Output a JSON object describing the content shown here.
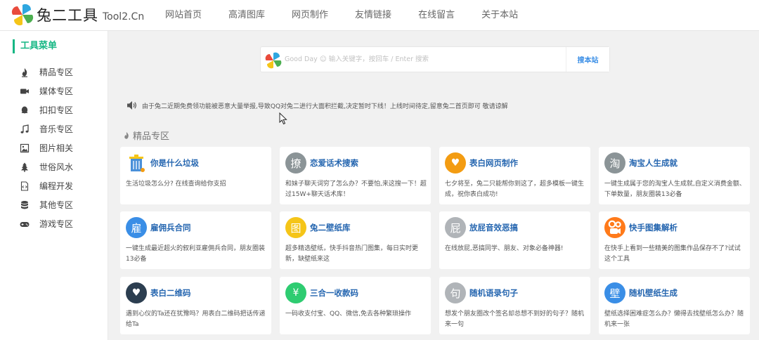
{
  "header": {
    "logo_text": "兔二工具",
    "logo_sub": "Tool2.Cn",
    "nav": [
      "网站首页",
      "高清图库",
      "网页制作",
      "友情链接",
      "在线留言",
      "关于本站"
    ]
  },
  "sidebar": {
    "title": "工具菜单",
    "items": [
      {
        "label": "精品专区",
        "icon": "flame-icon"
      },
      {
        "label": "媒体专区",
        "icon": "video-icon"
      },
      {
        "label": "扣扣专区",
        "icon": "qq-icon"
      },
      {
        "label": "音乐专区",
        "icon": "music-icon"
      },
      {
        "label": "图片相关",
        "icon": "image-icon"
      },
      {
        "label": "世俗风水",
        "icon": "tree-icon"
      },
      {
        "label": "编程开发",
        "icon": "code-icon"
      },
      {
        "label": "其他专区",
        "icon": "database-icon"
      },
      {
        "label": "游戏专区",
        "icon": "gamepad-icon"
      }
    ]
  },
  "search": {
    "placeholder": "Good Day ☺ 输入关键字，按回车 / Enter 搜索",
    "button": "搜本站"
  },
  "notice": "由于兔二近期免费领功能被恶意大量举报,导致QQ对兔二进行大面积拦截,决定暂时下线！上线时间待定,留意兔二首页即可 敬请谅解",
  "section": {
    "title": "精品专区"
  },
  "colors": {
    "accent": "#16b784",
    "link": "#2566b0"
  },
  "cards": [
    {
      "title": "你是什么垃圾",
      "desc": "生活垃圾怎么分? 在线查询给你支招",
      "glyph": "",
      "color": "#ffffff",
      "icon": "trash-bin-icon"
    },
    {
      "title": "恋爱话术搜索",
      "desc": "和妹子聊天词穷了怎么办？不要怕,来这搜一下！超过15W+聊天话术库！",
      "glyph": "撩",
      "color": "#8b9497",
      "icon": "char-icon"
    },
    {
      "title": "表白网页制作",
      "desc": "七夕将至，兔二只能帮你到这了，超多模板一键生成，祝你表白成功!",
      "glyph": "♥",
      "color": "#f39c12",
      "icon": "heart-icon"
    },
    {
      "title": "淘宝人生成就",
      "desc": "一键生成属于您的淘宝人生成就,自定义消费金额、下单数量，朋友圈装13必备",
      "glyph": "淘",
      "color": "#8b9497",
      "icon": "char-icon"
    },
    {
      "title": "雇佣兵合同",
      "desc": "一键生成最近超火的叙利亚雇佣兵合同，朋友圈装13必备",
      "glyph": "雇",
      "color": "#3a8ee6",
      "icon": "char-icon"
    },
    {
      "title": "兔二壁纸库",
      "desc": "超多精选壁纸，快手抖音热门图集，每日实时更新，缺壁纸来这",
      "glyph": "图",
      "color": "#f5c518",
      "icon": "char-icon"
    },
    {
      "title": "放屁音效恶搞",
      "desc": "在线放屁,恶搞同学、朋友、对象必备神器!",
      "glyph": "屁",
      "color": "#b0b4b8",
      "icon": "char-icon"
    },
    {
      "title": "快手图集解析",
      "desc": "在快手上看到一些精美的图集作品保存不了?试试这个工具",
      "glyph": "",
      "color": "#ff7a1a",
      "icon": "kuaishou-icon"
    },
    {
      "title": "表白二维码",
      "desc": "遇到心仪的Ta还在犹豫吗？用表白二维码把话传递给Ta",
      "glyph": "♥",
      "color": "#2c3e50",
      "icon": "heart-icon"
    },
    {
      "title": "三合一收款码",
      "desc": "一码收支付宝、QQ、微信,免去各种繁琐操作",
      "glyph": "¥",
      "color": "#2ecc71",
      "icon": "yen-icon"
    },
    {
      "title": "随机语录句子",
      "desc": "想发个朋友圈改个签名却总想不到好的句子？随机来一句",
      "glyph": "句",
      "color": "#b0b4b8",
      "icon": "char-icon"
    },
    {
      "title": "随机壁纸生成",
      "desc": "壁纸选择困难症怎么办？懒得去找壁纸怎么办？随机来一张",
      "glyph": "壁",
      "color": "#3a8ee6",
      "icon": "char-icon"
    }
  ]
}
